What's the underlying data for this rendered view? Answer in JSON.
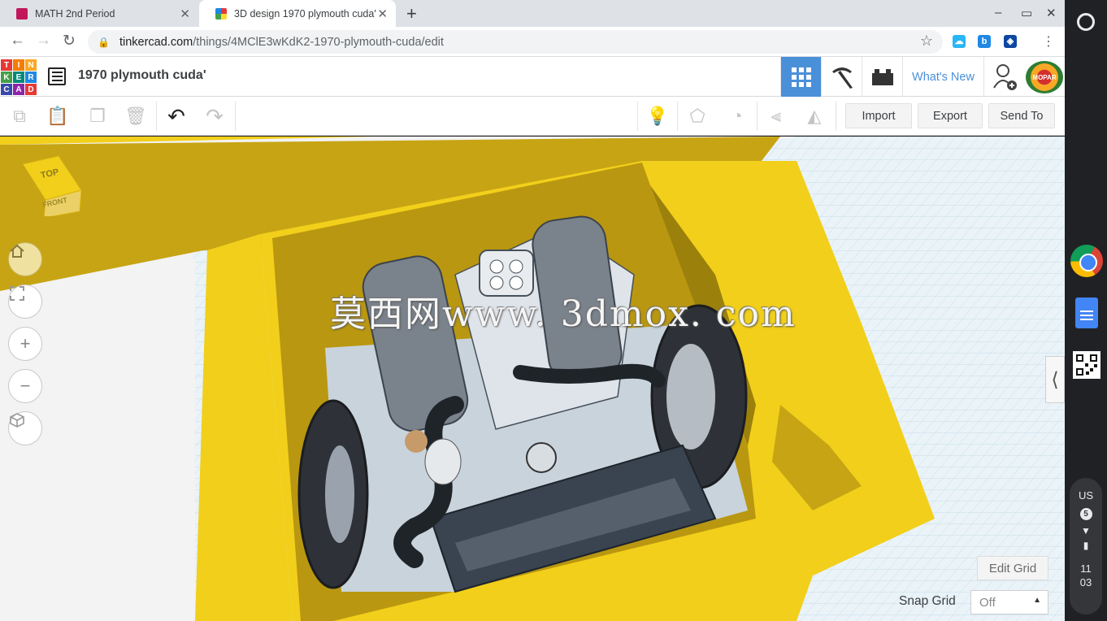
{
  "browser": {
    "tabs": [
      {
        "title": "MATH 2nd Period",
        "active": false
      },
      {
        "title": "3D design 1970 plymouth cuda'",
        "active": true
      }
    ],
    "url_host": "tinkercad.com",
    "url_path": "/things/4MClE3wKdK2-1970-plymouth-cuda/edit",
    "window_controls": [
      "–",
      "▭",
      "✕"
    ]
  },
  "tinkercad": {
    "logo_letters": [
      "T",
      "I",
      "N",
      "K",
      "E",
      "R",
      "C",
      "A",
      "D"
    ],
    "logo_colors": [
      "#e53935",
      "#f57c00",
      "#f9a825",
      "#43a047",
      "#00897b",
      "#1e88e5",
      "#3949ab",
      "#8e24aa",
      "#e53935"
    ],
    "design_title": "1970 plymouth cuda'",
    "whats_new": "What's New",
    "avatar_text": "MOPAR",
    "toolbar": {
      "import_label": "Import",
      "export_label": "Export",
      "send_to_label": "Send To"
    },
    "view_cube": {
      "top_label": "TOP",
      "front_label": "FRONT"
    },
    "watermark": "莫西网www. 3dmox. com",
    "edit_grid_label": "Edit Grid",
    "snap_grid_label": "Snap Grid",
    "snap_grid_value": "Off"
  },
  "system_tray": {
    "locale": "US",
    "notifications": "5",
    "time_hour": "11",
    "time_minute": "03"
  },
  "colors": {
    "accent_blue": "#4a90d9",
    "model_yellow": "#f2cf1a",
    "model_yellow_dark": "#c7a414",
    "engine_gray": "#8e98a4",
    "grid_blue": "#cfe3ee"
  }
}
